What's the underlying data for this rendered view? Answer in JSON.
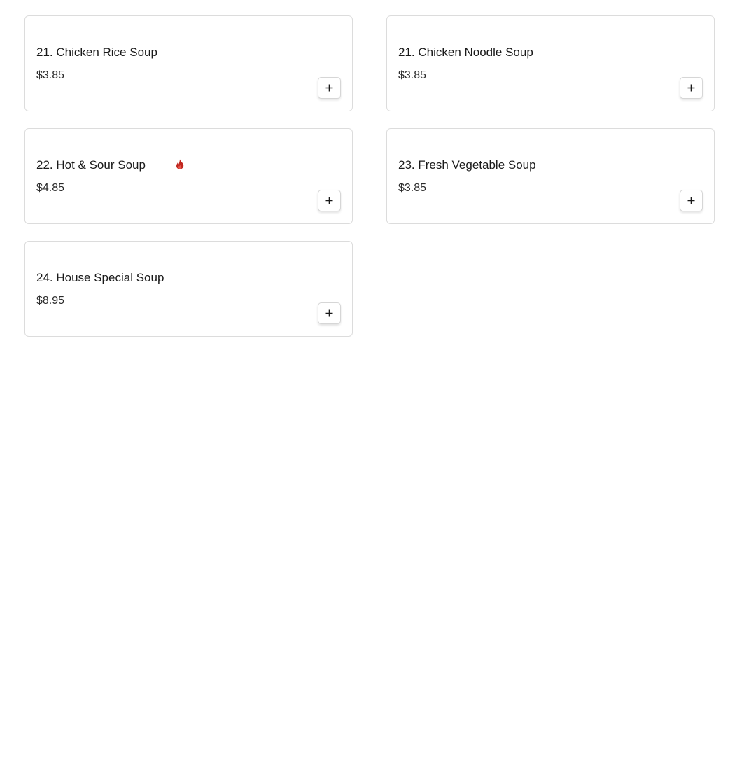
{
  "colors": {
    "spicy": "#c0271f",
    "card_border": "#dcdcdc",
    "text": "#1a1a1a"
  },
  "items": [
    {
      "name": "21. Chicken Rice Soup",
      "price": "$3.85",
      "spicy": false,
      "add_icon": "plus-icon"
    },
    {
      "name": "21. Chicken Noodle Soup",
      "price": "$3.85",
      "spicy": false,
      "add_icon": "plus-icon"
    },
    {
      "name": "22. Hot & Sour Soup",
      "price": "$4.85",
      "spicy": true,
      "spicy_icon": "flame-icon",
      "add_icon": "plus-icon"
    },
    {
      "name": "23. Fresh Vegetable Soup",
      "price": "$3.85",
      "spicy": false,
      "add_icon": "plus-icon"
    },
    {
      "name": "24. House Special Soup",
      "price": "$8.95",
      "spicy": false,
      "add_icon": "plus-icon"
    }
  ]
}
